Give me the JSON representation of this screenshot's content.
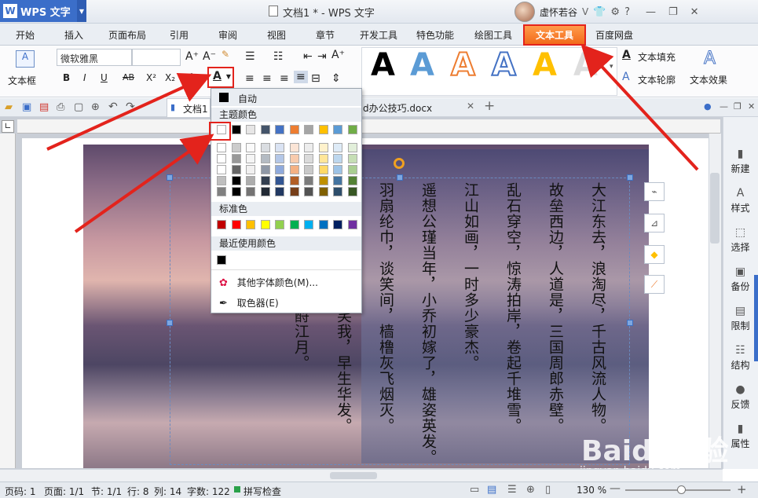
{
  "titlebar": {
    "app": "WPS 文字",
    "doc_title": "文档1 * - WPS 文字",
    "user": "虚怀若谷",
    "user_arrow": "V",
    "help": "?"
  },
  "menu": [
    "开始",
    "插入",
    "页面布局",
    "引用",
    "审阅",
    "视图",
    "章节",
    "开发工具",
    "特色功能",
    "绘图工具",
    "文本工具",
    "百度网盘"
  ],
  "ribbon": {
    "textbox_label": "文本框",
    "font_name": "微软雅黑",
    "bold": "B",
    "italic": "I",
    "underline": "U",
    "strike": "AB",
    "sup": "X²",
    "sub": "X₂",
    "style_glyph": "A",
    "text_fill": "文本填充",
    "text_outline": "文本轮廓",
    "text_effect": "文本效果"
  },
  "tabs": {
    "doc1": "文档1",
    "doc2": "d办公技巧.docx"
  },
  "poem_cols": [
    "大江东去，浪淘尽，千古风流人物。",
    "故垒西边，人道是，三国周郎赤壁。",
    "乱石穿空，惊涛拍岸，卷起千堆雪。",
    "江山如画，一时多少豪杰。",
    "遥想公瑾当年，小乔初嫁了，雄姿英发。",
    "羽扇纶巾，谈笑间，樯橹灰飞烟灭。",
    "故国神游，多情应笑我，早生华发。",
    "人生如梦，一尊还酹江月。"
  ],
  "color_popup": {
    "auto": "自动",
    "theme": "主题颜色",
    "standard": "标准色",
    "recent": "最近使用颜色",
    "more": "其他字体颜色(M)...",
    "picker": "取色器(E)",
    "theme_top": [
      "#ffffff",
      "#000000",
      "#e7e6e6",
      "#44546a",
      "#4472c4",
      "#ed7d31",
      "#a5a5a5",
      "#ffc000",
      "#5b9bd5",
      "#70ad47"
    ],
    "standard_colors": [
      "#c00000",
      "#ff0000",
      "#ffc000",
      "#ffff00",
      "#92d050",
      "#00b050",
      "#00b0f0",
      "#0070c0",
      "#002060",
      "#7030a0"
    ]
  },
  "sidebar": [
    "新建",
    "样式",
    "选择",
    "备份",
    "限制",
    "结构",
    "反馈",
    "属性"
  ],
  "status": {
    "page": "页码: 1",
    "pages": "页面: 1/1",
    "section": "节: 1/1",
    "row": "行: 8",
    "col": "列: 14",
    "words": "字数: 122",
    "spell": "拼写检查",
    "zoom": "130 %"
  },
  "watermark": {
    "logo": "Baidu经验",
    "url": "jingyan.baidu.com"
  }
}
